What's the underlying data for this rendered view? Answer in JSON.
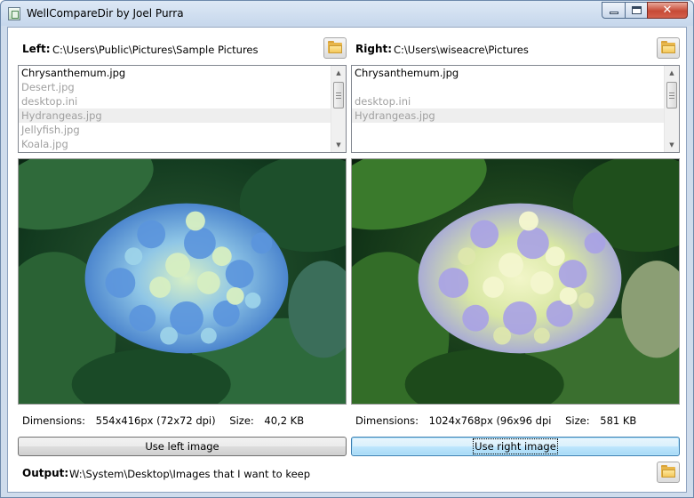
{
  "window": {
    "title": "WellCompareDir by Joel Purra",
    "icon": "app-window-icon",
    "controls": [
      "minimize-icon",
      "maximize-icon",
      "close-icon"
    ],
    "close_label": "✕"
  },
  "left": {
    "label": "Left:",
    "path": "C:\\Users\\Public\\Pictures\\Sample Pictures",
    "files": [
      {
        "name": "Chrysanthemum.jpg",
        "exists_in_other": true,
        "selected": false
      },
      {
        "name": "Desert.jpg",
        "exists_in_other": false,
        "selected": false
      },
      {
        "name": "desktop.ini",
        "exists_in_other": false,
        "selected": false
      },
      {
        "name": "Hydrangeas.jpg",
        "exists_in_other": false,
        "selected": true
      },
      {
        "name": "Jellyfish.jpg",
        "exists_in_other": false,
        "selected": false
      },
      {
        "name": "Koala.jpg",
        "exists_in_other": false,
        "selected": false
      }
    ],
    "dimensions_label": "Dimensions:",
    "dimensions": "554x416px (72x72 dpi)",
    "size_label": "Size:",
    "size": "40,2 KB",
    "use_button": "Use left image"
  },
  "right": {
    "label": "Right:",
    "path": "C:\\Users\\wiseacre\\Pictures",
    "files": [
      {
        "name": "Chrysanthemum.jpg",
        "exists_in_other": true,
        "selected": false
      },
      {
        "name": "",
        "exists_in_other": false,
        "selected": false
      },
      {
        "name": "desktop.ini",
        "exists_in_other": false,
        "selected": false
      },
      {
        "name": "Hydrangeas.jpg",
        "exists_in_other": false,
        "selected": true
      }
    ],
    "dimensions_label": "Dimensions:",
    "dimensions": "1024x768px (96x96 dpi",
    "size_label": "Size:",
    "size": "581 KB",
    "use_button": "Use right image"
  },
  "output": {
    "label": "Output:",
    "path": "W:\\System\\Desktop\\Images that I want to keep"
  },
  "colors": {
    "window_frame": "#cfdcec",
    "missing_file_text": "#a0a0a0",
    "focused_button": "#bee6fd"
  }
}
